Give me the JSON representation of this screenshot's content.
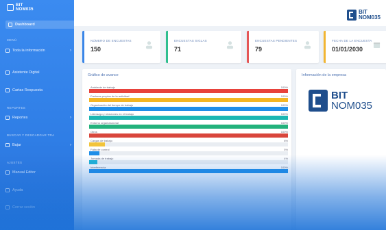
{
  "brand": {
    "line1": "BIT",
    "line2": "NOM035"
  },
  "sidebar": {
    "items": [
      {
        "label": "Dashboard",
        "active": true
      },
      {
        "label": "Toda la información",
        "caret": "›"
      },
      {
        "label": "Asistente Digital"
      },
      {
        "label": "Cartas Respuesta"
      },
      {
        "label": "Reportes",
        "caret": "›"
      },
      {
        "label": "Bajar",
        "caret": "›"
      },
      {
        "label": "Manual Editor"
      },
      {
        "label": "Ayuda"
      },
      {
        "label": "Cerrar sesión"
      }
    ],
    "sections": [
      "MENÚ",
      "REPORTES",
      "BUSCAR Y DESCARGAR TRA",
      "AJUSTES"
    ]
  },
  "cards": [
    {
      "label": "NÚMERO DE ENCUESTAS",
      "value": "150",
      "color": "#3a86e8"
    },
    {
      "label": "ENCUESTAS SIGLAS",
      "value": "71",
      "color": "#2fbf8f"
    },
    {
      "label": "ENCUESTAS PENDIENTES",
      "value": "79",
      "color": "#e55656"
    },
    {
      "label": "FECHA DE LA ENCUESTA",
      "value": "01/01/2030",
      "color": "#f2b531"
    }
  ],
  "progress": {
    "title": "Gráfico de avance",
    "rows": [
      {
        "label": "Ambiente de trabajo",
        "pct_text": "100%",
        "value": 100,
        "color": "#e8423b"
      },
      {
        "label": "Factores propios de la actividad",
        "pct_text": "100%",
        "value": 100,
        "color": "#f4b623"
      },
      {
        "label": "Organización del tiempo de trabajo",
        "pct_text": "100%",
        "value": 100,
        "color": "#1f8ee8"
      },
      {
        "label": "Liderazgo y relaciones en el trabajo",
        "pct_text": "100%",
        "value": 100,
        "color": "#1bb7b3"
      },
      {
        "label": "Entorno organizacional",
        "pct_text": "100%",
        "value": 100,
        "color": "#23b27c"
      },
      {
        "label": "Otros",
        "pct_text": "100%",
        "value": 100,
        "color": "#d9463c"
      },
      {
        "label": "Cargas de trabajo",
        "pct_text": "8%",
        "value": 8,
        "color": "#f2c43b"
      },
      {
        "label": "Falta de control",
        "pct_text": "5%",
        "value": 5,
        "color": "#1f8ee8"
      },
      {
        "label": "Jornada de trabajo",
        "pct_text": "4%",
        "value": 4,
        "color": "#20b3d6"
      },
      {
        "label": "Interferencia",
        "pct_text": "100%",
        "value": 100,
        "color": "#1f8ee8"
      }
    ]
  },
  "info": {
    "title": "Información de la empresa",
    "logo_line1": "BIT",
    "logo_line2": "NOM035"
  }
}
